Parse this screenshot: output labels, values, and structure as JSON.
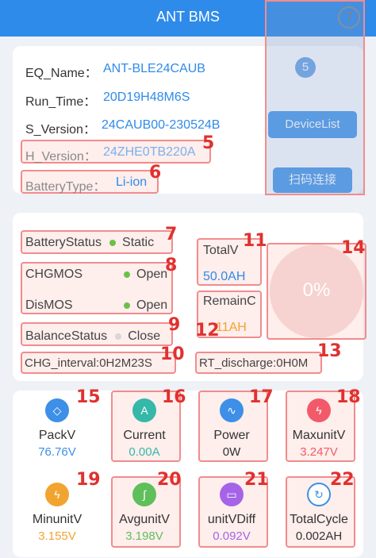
{
  "app": {
    "title": "ANT BMS",
    "help_icon": "?"
  },
  "info": {
    "eq_name_label": "EQ_Name：",
    "eq_name_value": "ANT-BLE24CAUB",
    "run_time_label": "Run_Time：",
    "run_time_value": "20D19H48M6S",
    "s_version_label": "S_Version：",
    "s_version_value": "24CAUB00-230524B",
    "h_version_label": "H_Version：",
    "h_version_value": "24ZHE0TB220A",
    "battery_type_label": "BatteryType：",
    "battery_type_value": "Li-ion",
    "count_badge": "5",
    "device_list_button": "DeviceList",
    "scan_connect_button": "扫码连接"
  },
  "status": {
    "battery_status_label": "BatteryStatus",
    "battery_status_value": "Static",
    "chg_mos_label": "CHGMOS",
    "chg_mos_value": "Open",
    "dis_mos_label": "DisMOS",
    "dis_mos_value": "Open",
    "balance_status_label": "BalanceStatus",
    "balance_status_value": "Close",
    "chg_interval": "CHG_interval:0H2M23S",
    "total_v_label": "TotalV",
    "total_v_value": "50.0AH",
    "remain_label": "RemainC",
    "remain_value": "11AH",
    "rt_discharge": "RT_discharge:0H0M",
    "soc": "0%"
  },
  "metrics": [
    {
      "label": "PackV",
      "value": "76.76V",
      "icon": "diamond-icon",
      "color": "#3d8fe8",
      "value_color": "#3d8fe8"
    },
    {
      "label": "Current",
      "value": "0.00A",
      "icon": "ampere-icon",
      "color": "#35b8a8",
      "value_color": "#35b8a8"
    },
    {
      "label": "Power",
      "value": "0W",
      "icon": "pulse-icon",
      "color": "#3d8fe8",
      "value_color": "#333333"
    },
    {
      "label": "MaxunitV",
      "value": "3.247V",
      "icon": "bolt-up-icon",
      "color": "#f25a6a",
      "value_color": "#f25a6a"
    },
    {
      "label": "MinunitV",
      "value": "3.155V",
      "icon": "bolt-down-icon",
      "color": "#f2a431",
      "value_color": "#f2a431"
    },
    {
      "label": "AvgunitV",
      "value": "3.198V",
      "icon": "wave-icon",
      "color": "#5fbf5a",
      "value_color": "#5fbf5a"
    },
    {
      "label": "unitVDiff",
      "value": "0.092V",
      "icon": "battery-diff-icon",
      "color": "#a564e8",
      "value_color": "#a564e8"
    },
    {
      "label": "TotalCycle",
      "value": "0.002AH",
      "icon": "cycle-icon",
      "color": "#3d8fe8",
      "value_color": "#333333"
    }
  ],
  "annotations": [
    "5",
    "6",
    "7",
    "8",
    "9",
    "10",
    "11",
    "12",
    "13",
    "14",
    "15",
    "16",
    "17",
    "18",
    "19",
    "20",
    "21",
    "22"
  ]
}
